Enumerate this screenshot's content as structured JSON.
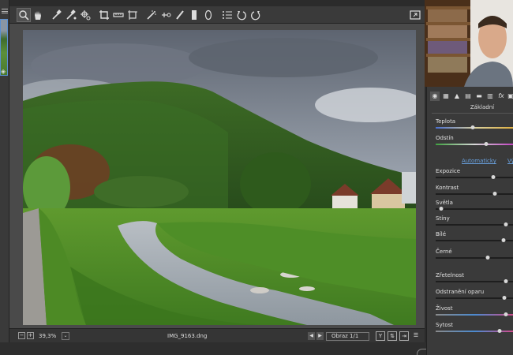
{
  "statusbar": {
    "zoom": "39,3%",
    "filename": "IMG_9163.dng",
    "image_counter": "Obraz 1/1"
  },
  "panel": {
    "title": "Základní",
    "auto_link": "Automaticky",
    "default_link": "Vý",
    "sliders": [
      {
        "label": "Teplota",
        "level": 0.47
      },
      {
        "label": "Odstín",
        "level": 0.65
      },
      {
        "label": "Expozice",
        "level": 0.74
      },
      {
        "label": "Kontrast",
        "level": 0.76
      },
      {
        "label": "Světla",
        "level": 0.07
      },
      {
        "label": "Stíny",
        "level": 0.9
      },
      {
        "label": "Bílé",
        "level": 0.87
      },
      {
        "label": "Černé",
        "level": 0.67
      },
      {
        "label": "Zřetelnost",
        "level": 0.9
      },
      {
        "label": "Odstranění oparu",
        "level": 0.88
      },
      {
        "label": "Živost",
        "level": 0.9
      },
      {
        "label": "Sytost",
        "level": 0.82
      }
    ]
  },
  "colors": {
    "accent": "#5a8fd0",
    "panel_bg": "#3a3a3a",
    "toolbar_bg": "#3a3a3a",
    "link": "#6aa2e0"
  }
}
